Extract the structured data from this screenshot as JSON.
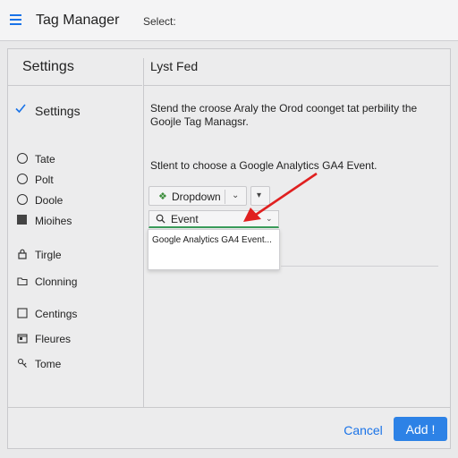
{
  "header": {
    "title": "Tag Manager",
    "select_label": "Select:"
  },
  "sidebar": {
    "heading": "Settings",
    "active_item": "Settings",
    "items": [
      {
        "label": "Tate",
        "icon": "radio-icon"
      },
      {
        "label": "Polt",
        "icon": "radio-icon"
      },
      {
        "label": "Doole",
        "icon": "radio-icon"
      },
      {
        "label": "Mioihes",
        "icon": "square-icon"
      },
      {
        "label": "Tirgle",
        "icon": "lock-icon"
      },
      {
        "label": "Clonning",
        "icon": "folder-icon"
      },
      {
        "label": "Centings",
        "icon": "checkbox-icon"
      },
      {
        "label": "Fleures",
        "icon": "calendar-icon"
      },
      {
        "label": "Tome",
        "icon": "link-icon"
      }
    ]
  },
  "content": {
    "title": "Lyst Fed",
    "description": "Stend the croose Araly the Orod coonget tat perbility the Goojle Tag Managsr.",
    "instruction": "Stlent to choose a Google Analytics GA4 Event.",
    "dropdown_label": "Dropdown",
    "event_input_value": "Event",
    "suggestion": "Google Analytics GA4 Event..."
  },
  "footer": {
    "cancel_label": "Cancel",
    "add_label": "Add !"
  },
  "colors": {
    "accent": "#1a73e8",
    "primary_button": "#2d82e6",
    "annotation_arrow": "#e02020",
    "input_underline": "#3a9c5a"
  }
}
